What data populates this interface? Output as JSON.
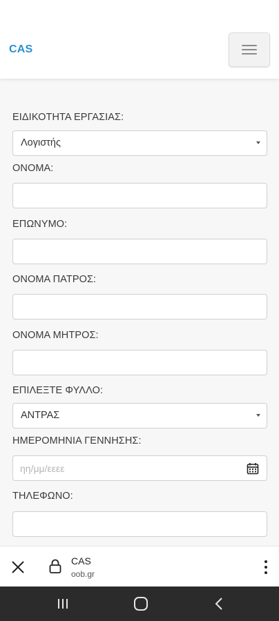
{
  "header": {
    "brand": "CAS",
    "menu_icon": "hamburger-icon"
  },
  "form": {
    "specialty": {
      "label": "ΕΙΔΙΚΟΤΗΤΑ ΕΡΓΑΣΙΑΣ:",
      "value": "Λογιστής"
    },
    "first_name": {
      "label": "ΟΝΟΜΑ:",
      "value": ""
    },
    "last_name": {
      "label": "ΕΠΩΝΥΜΟ:",
      "value": ""
    },
    "father_name": {
      "label": "ΟΝΟΜΑ ΠΑΤΡΟΣ:",
      "value": ""
    },
    "mother_name": {
      "label": "ΟΝΟΜΑ ΜΗΤΡΟΣ:",
      "value": ""
    },
    "gender": {
      "label": "ΕΠΙΛΕΞΤΕ ΦΥΛΛΟ:",
      "value": "ΑΝΤΡΑΣ"
    },
    "birth_date": {
      "label": "ΗΜΕΡΟΜΗΝΙΑ ΓΕΝΝΗΣΗΣ:",
      "placeholder": "ηη/μμ/εεεε"
    },
    "phone": {
      "label": "ΤΗΛΕΦΩΝΟ:",
      "value": ""
    }
  },
  "browser_bar": {
    "title": "CAS",
    "url": "oob.gr"
  },
  "icons": {
    "close": "close-icon",
    "lock": "lock-icon",
    "more": "more-vert-icon",
    "recents": "recents-icon",
    "home": "home-icon",
    "back": "back-icon"
  },
  "colors": {
    "brand": "#2a8fd0",
    "page_background": "#f7f7f7",
    "system_nav": "#2b2b2b"
  }
}
